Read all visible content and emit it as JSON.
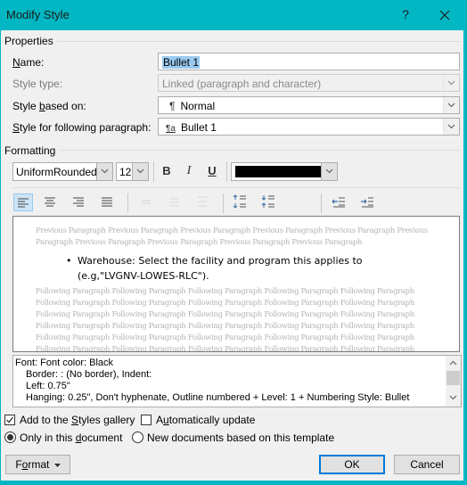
{
  "window": {
    "title": "Modify Style",
    "help_label": "?",
    "accent_color": "#00b7c3"
  },
  "properties": {
    "group_label": "Properties",
    "name": {
      "label_pre": "",
      "label_u": "N",
      "label_post": "ame:",
      "value": "Bullet 1"
    },
    "style_type": {
      "label": "Style type:",
      "value": "Linked (paragraph and character)",
      "disabled": true
    },
    "based_on": {
      "label_pre": "Style ",
      "label_u": "b",
      "label_post": "ased on:",
      "icon": "¶",
      "value": "Normal"
    },
    "following": {
      "label_pre": "",
      "label_u": "S",
      "label_post": "tyle for following paragraph:",
      "icon": "¶a",
      "value": "Bullet 1"
    }
  },
  "formatting": {
    "group_label": "Formatting",
    "font_name": "UniformRounded-",
    "font_size": "12",
    "bold_label": "B",
    "italic_label": "I",
    "underline_label": "U",
    "font_color": "#000000",
    "alignment_buttons": [
      "align-left",
      "align-center",
      "align-right",
      "justify"
    ],
    "active_alignment": "align-left",
    "spacing_buttons": [
      "single-spacing",
      "one-half-spacing",
      "double-spacing"
    ],
    "paragraph_buttons": [
      "increase-paragraph-spacing",
      "decrease-paragraph-spacing"
    ],
    "indent_buttons": [
      "decrease-indent",
      "increase-indent"
    ]
  },
  "preview": {
    "previous_lines": [
      "Previous Paragraph Previous Paragraph Previous Paragraph Previous Paragraph Previous Paragraph Previous",
      "Paragraph Previous Paragraph Previous Paragraph Previous Paragraph Previous Paragraph"
    ],
    "bullet": "•",
    "sample_text": "Warehouse: Select the facility and program this applies to (e.g,\"LVGNV-LOWES-RLC\").",
    "following_lines": [
      "Following Paragraph Following Paragraph Following Paragraph Following Paragraph Following Paragraph",
      "Following Paragraph Following Paragraph Following Paragraph Following Paragraph Following Paragraph",
      "Following Paragraph Following Paragraph Following Paragraph Following Paragraph Following Paragraph",
      "Following Paragraph Following Paragraph Following Paragraph Following Paragraph Following Paragraph",
      "Following Paragraph Following Paragraph Following Paragraph Following Paragraph Following Paragraph",
      "Following Paragraph Following Paragraph Following Paragraph Following Paragraph Following Paragraph"
    ]
  },
  "description": {
    "lines": [
      "Font: Font color: Black",
      "Border: : (No border), Indent:",
      "Left:  0.75\"",
      "Hanging:  0.25\", Don't hyphenate, Outline numbered + Level: 1 + Numbering Style: Bullet"
    ]
  },
  "options": {
    "add_to_gallery": {
      "label_pre": "Add to the ",
      "label_u": "S",
      "label_post": "tyles gallery",
      "checked": true
    },
    "auto_update": {
      "label_pre": "A",
      "label_u": "u",
      "label_post": "tomatically update",
      "checked": false
    },
    "only_this_doc": {
      "label_pre": "Only in this ",
      "label_u": "d",
      "label_post": "ocument",
      "selected": true
    },
    "new_docs": {
      "label": "New documents based on this template",
      "selected": false
    }
  },
  "buttons": {
    "format_pre": "F",
    "format_u": "o",
    "format_post": "rmat",
    "ok": "OK",
    "cancel": "Cancel"
  }
}
